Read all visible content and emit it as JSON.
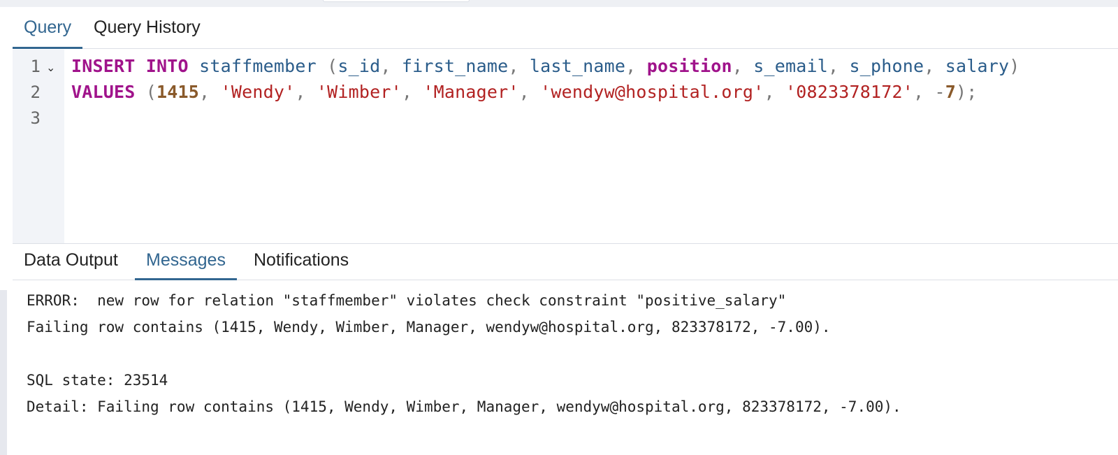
{
  "query_tabs": [
    {
      "label": "Query",
      "active": true
    },
    {
      "label": "Query History",
      "active": false
    }
  ],
  "editor": {
    "line_numbers": [
      "1",
      "2",
      "3"
    ],
    "line1": [
      {
        "t": "INSERT",
        "c": "kw"
      },
      {
        "t": " ",
        "c": "punc"
      },
      {
        "t": "INTO",
        "c": "kw"
      },
      {
        "t": " ",
        "c": "punc"
      },
      {
        "t": "staffmember",
        "c": "ident"
      },
      {
        "t": " (",
        "c": "punc"
      },
      {
        "t": "s_id",
        "c": "ident"
      },
      {
        "t": ", ",
        "c": "punc"
      },
      {
        "t": "first_name",
        "c": "ident"
      },
      {
        "t": ", ",
        "c": "punc"
      },
      {
        "t": "last_name",
        "c": "ident"
      },
      {
        "t": ", ",
        "c": "punc"
      },
      {
        "t": "position",
        "c": "kw"
      },
      {
        "t": ", ",
        "c": "punc"
      },
      {
        "t": "s_email",
        "c": "ident"
      },
      {
        "t": ", ",
        "c": "punc"
      },
      {
        "t": "s_phone",
        "c": "ident"
      },
      {
        "t": ", ",
        "c": "punc"
      },
      {
        "t": "salary",
        "c": "ident"
      },
      {
        "t": ")",
        "c": "punc"
      }
    ],
    "line2": [
      {
        "t": "VALUES",
        "c": "kw"
      },
      {
        "t": " (",
        "c": "punc"
      },
      {
        "t": "1415",
        "c": "num"
      },
      {
        "t": ", ",
        "c": "punc"
      },
      {
        "t": "'Wendy'",
        "c": "str"
      },
      {
        "t": ", ",
        "c": "punc"
      },
      {
        "t": "'Wimber'",
        "c": "str"
      },
      {
        "t": ", ",
        "c": "punc"
      },
      {
        "t": "'Manager'",
        "c": "str"
      },
      {
        "t": ", ",
        "c": "punc"
      },
      {
        "t": "'wendyw@hospital.org'",
        "c": "str"
      },
      {
        "t": ", ",
        "c": "punc"
      },
      {
        "t": "'0823378172'",
        "c": "str"
      },
      {
        "t": ", -",
        "c": "punc"
      },
      {
        "t": "7",
        "c": "num"
      },
      {
        "t": ");",
        "c": "punc"
      }
    ]
  },
  "result_tabs": [
    {
      "label": "Data Output",
      "active": false
    },
    {
      "label": "Messages",
      "active": true
    },
    {
      "label": "Notifications",
      "active": false
    }
  ],
  "messages": [
    "ERROR:  new row for relation \"staffmember\" violates check constraint \"positive_salary\"",
    "Failing row contains (1415, Wendy, Wimber, Manager, wendyw@hospital.org, 823378172, -7.00).",
    "",
    "SQL state: 23514",
    "Detail: Failing row contains (1415, Wendy, Wimber, Manager, wendyw@hospital.org, 823378172, -7.00)."
  ],
  "colors": {
    "accent": "#326690",
    "keyword": "#a0138b",
    "identifier": "#2a5c8a",
    "string": "#b22222",
    "number": "#8a5a2b"
  }
}
